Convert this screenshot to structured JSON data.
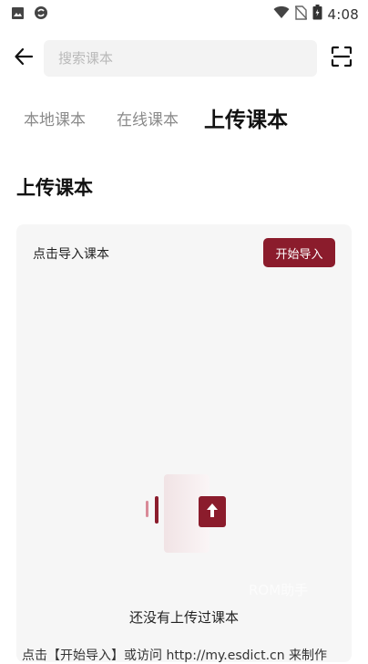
{
  "status_bar": {
    "time": "4:08",
    "left_icons": [
      "image-icon",
      "sync-icon"
    ],
    "right_icons": [
      "wifi-icon",
      "no-sim-icon",
      "battery-icon"
    ]
  },
  "top_bar": {
    "back_icon": "back-arrow-icon",
    "search_placeholder": "搜索课本",
    "scan_icon": "scan-icon"
  },
  "tabs": [
    {
      "label": "本地课本",
      "active": false
    },
    {
      "label": "在线课本",
      "active": false
    },
    {
      "label": "上传课本",
      "active": true
    }
  ],
  "section": {
    "title": "上传课本"
  },
  "card": {
    "label": "点击导入课本",
    "button_label": "开始导入",
    "empty_text": "还没有上传过课本",
    "hint_text": "点击【开始导入】或访问 http://my.esdict.cn 来制作",
    "watermark": "ROM助手"
  },
  "colors": {
    "accent": "#8b1c2c",
    "card_bg": "#f6f6f6",
    "search_bg": "#f3f3f3"
  }
}
